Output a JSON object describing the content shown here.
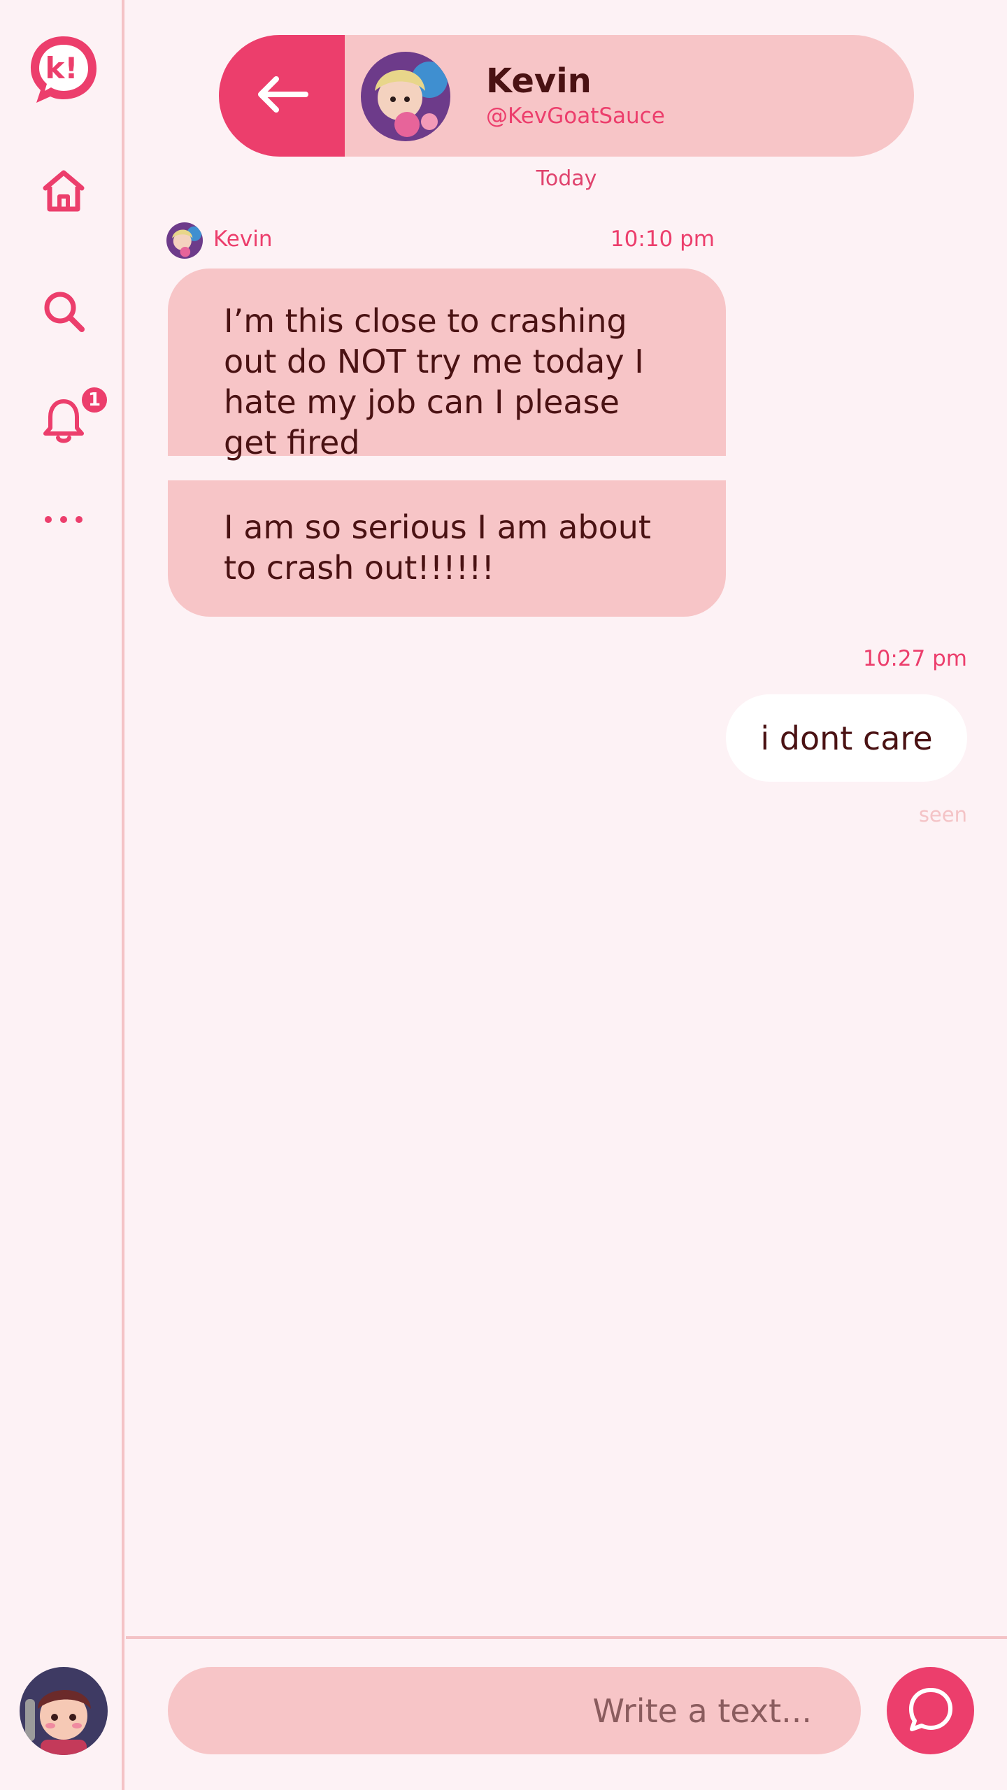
{
  "colors": {
    "accent": "#ec3e6c",
    "bubble_in": "#f7c5c7",
    "bubble_out": "#ffffff",
    "background": "#fdf2f5",
    "text_dark": "#4a1213",
    "divider": "#f4c3c6"
  },
  "sidebar": {
    "logo_text": "k!",
    "items": [
      {
        "name": "home",
        "icon": "home-icon"
      },
      {
        "name": "search",
        "icon": "search-icon"
      },
      {
        "name": "notifications",
        "icon": "bell-icon",
        "badge": "1"
      },
      {
        "name": "more",
        "icon": "more-icon"
      }
    ],
    "profile_avatar": "user-avatar"
  },
  "header": {
    "back_icon": "arrow-left-icon",
    "name": "Kevin",
    "handle": "@KevGoatSauce"
  },
  "chat": {
    "date_label": "Today",
    "incoming": {
      "sender": "Kevin",
      "time": "10:10 pm",
      "messages": [
        "I’m this close to crashing out do NOT try me today I hate my job can I please get fired",
        "I am so serious I am about to crash out!!!!!!"
      ]
    },
    "outgoing": {
      "time": "10:27 pm",
      "message": "i dont care",
      "status": "seen"
    }
  },
  "composer": {
    "placeholder": "Write a text...",
    "value": "",
    "send_icon": "chat-bubble-icon"
  }
}
